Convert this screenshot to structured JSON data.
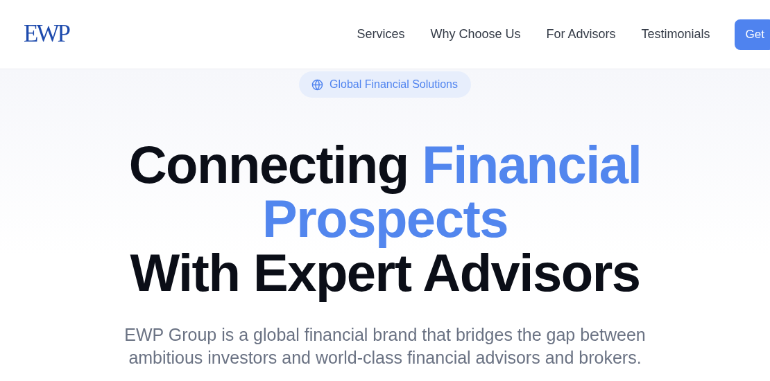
{
  "logo": "EWP",
  "nav": {
    "links": [
      "Services",
      "Why Choose Us",
      "For Advisors",
      "Testimonials"
    ],
    "button": "Get"
  },
  "hero": {
    "badge": "Global Financial Solutions",
    "headline": [
      {
        "parts": [
          {
            "text": "Connecting",
            "accent": false
          },
          {
            "text": "Financial",
            "accent": true
          }
        ]
      },
      {
        "parts": [
          {
            "text": "Prospects",
            "accent": true
          }
        ]
      },
      {
        "parts": [
          {
            "text": "With Expert Advisors",
            "accent": false
          }
        ]
      }
    ],
    "subtitle": "EWP Group is a global financial brand that bridges the gap between ambitious investors and world-class financial advisors and brokers."
  }
}
